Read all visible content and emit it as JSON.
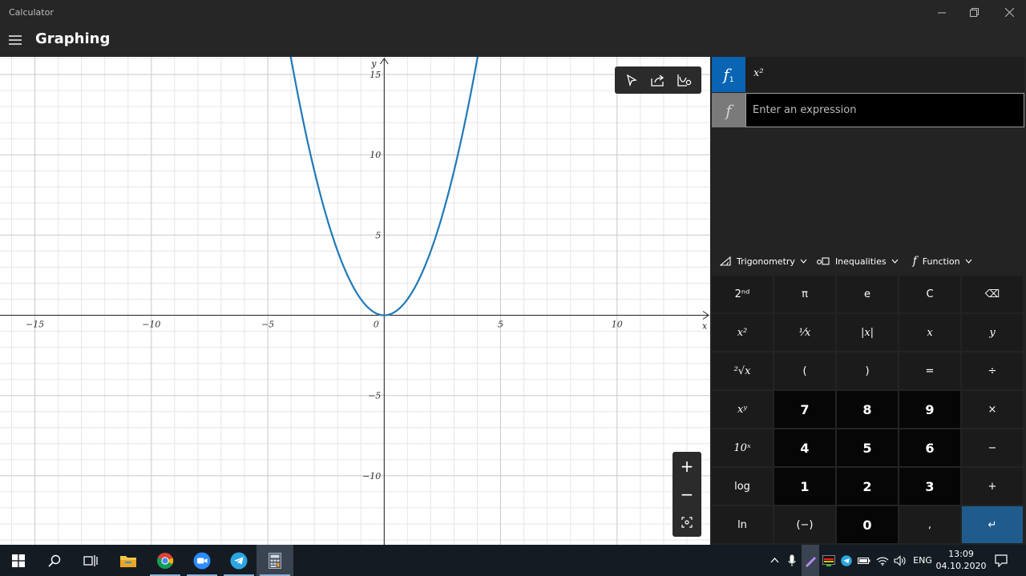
{
  "window": {
    "app_title": "Calculator",
    "mode_title": "Graphing"
  },
  "graph": {
    "x_axis_label": "x",
    "y_axis_label": "y",
    "x_ticks": [
      "−15",
      "−10",
      "−5",
      "0",
      "5",
      "10"
    ],
    "y_ticks": [
      "15",
      "10",
      "5",
      "−5",
      "−10"
    ],
    "curve_color": "#1f7ab8"
  },
  "chart_data": {
    "type": "line",
    "title": "",
    "xlabel": "x",
    "ylabel": "y",
    "xlim": [
      -16.5,
      14
    ],
    "ylim": [
      -14.3,
      16.1
    ],
    "grid": true,
    "series": [
      {
        "name": "x²",
        "function": "x^2",
        "x": [
          -4,
          -3,
          -2,
          -1,
          0,
          1,
          2,
          3,
          4
        ],
        "y": [
          16,
          9,
          4,
          1,
          0,
          1,
          4,
          9,
          16
        ]
      }
    ]
  },
  "functions": [
    {
      "badge": "f",
      "index": "1",
      "expression": "x²",
      "color": "#0a64b4"
    }
  ],
  "input": {
    "badge": "f",
    "placeholder": "Enter an expression"
  },
  "dropdowns": [
    {
      "label": "Trigonometry",
      "icon": "triangle-icon"
    },
    {
      "label": "Inequalities",
      "icon": "inequalities-icon"
    },
    {
      "label": "Function",
      "icon": "function-icon"
    }
  ],
  "keypad": {
    "rows": [
      [
        "2ⁿᵈ",
        "π",
        "e",
        "C",
        "⌫"
      ],
      [
        "x²",
        "¹⁄x",
        "|x|",
        "x",
        "y"
      ],
      [
        "²√x",
        "(",
        ")",
        "=",
        "÷"
      ],
      [
        "xʸ",
        "7",
        "8",
        "9",
        "×"
      ],
      [
        "10ˣ",
        "4",
        "5",
        "6",
        "−"
      ],
      [
        "log",
        "1",
        "2",
        "3",
        "+"
      ],
      [
        "ln",
        "(−)",
        "0",
        ",",
        "↵"
      ]
    ]
  },
  "zoom": {
    "in": "+",
    "out": "−"
  },
  "taskbar": {
    "language": "ENG",
    "time": "13:09",
    "date": "04.10.2020"
  }
}
